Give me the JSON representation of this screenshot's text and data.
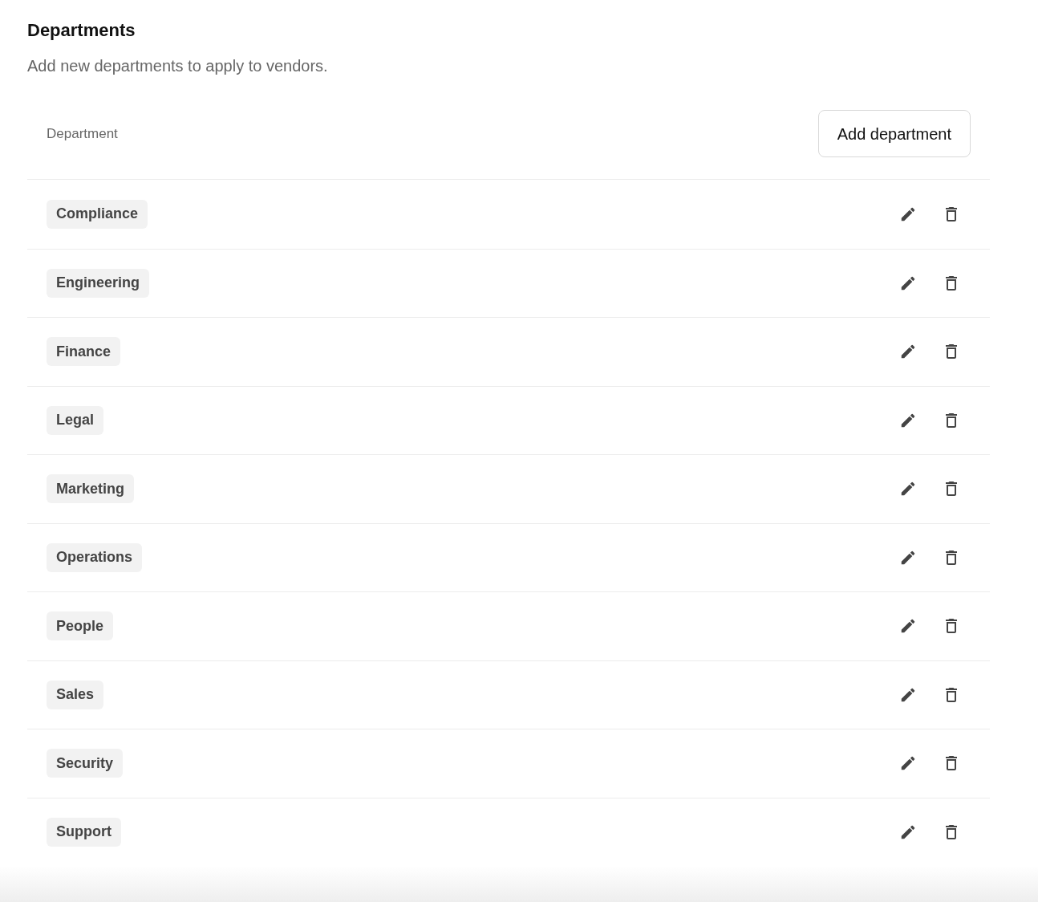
{
  "section": {
    "title": "Departments",
    "description": "Add new departments to apply to vendors."
  },
  "table": {
    "column_header": "Department",
    "add_button": "Add department",
    "rows": [
      {
        "department": "Compliance"
      },
      {
        "department": "Engineering"
      },
      {
        "department": "Finance"
      },
      {
        "department": "Legal"
      },
      {
        "department": "Marketing"
      },
      {
        "department": "Operations"
      },
      {
        "department": "People"
      },
      {
        "department": "Sales"
      },
      {
        "department": "Security"
      },
      {
        "department": "Support"
      }
    ]
  }
}
